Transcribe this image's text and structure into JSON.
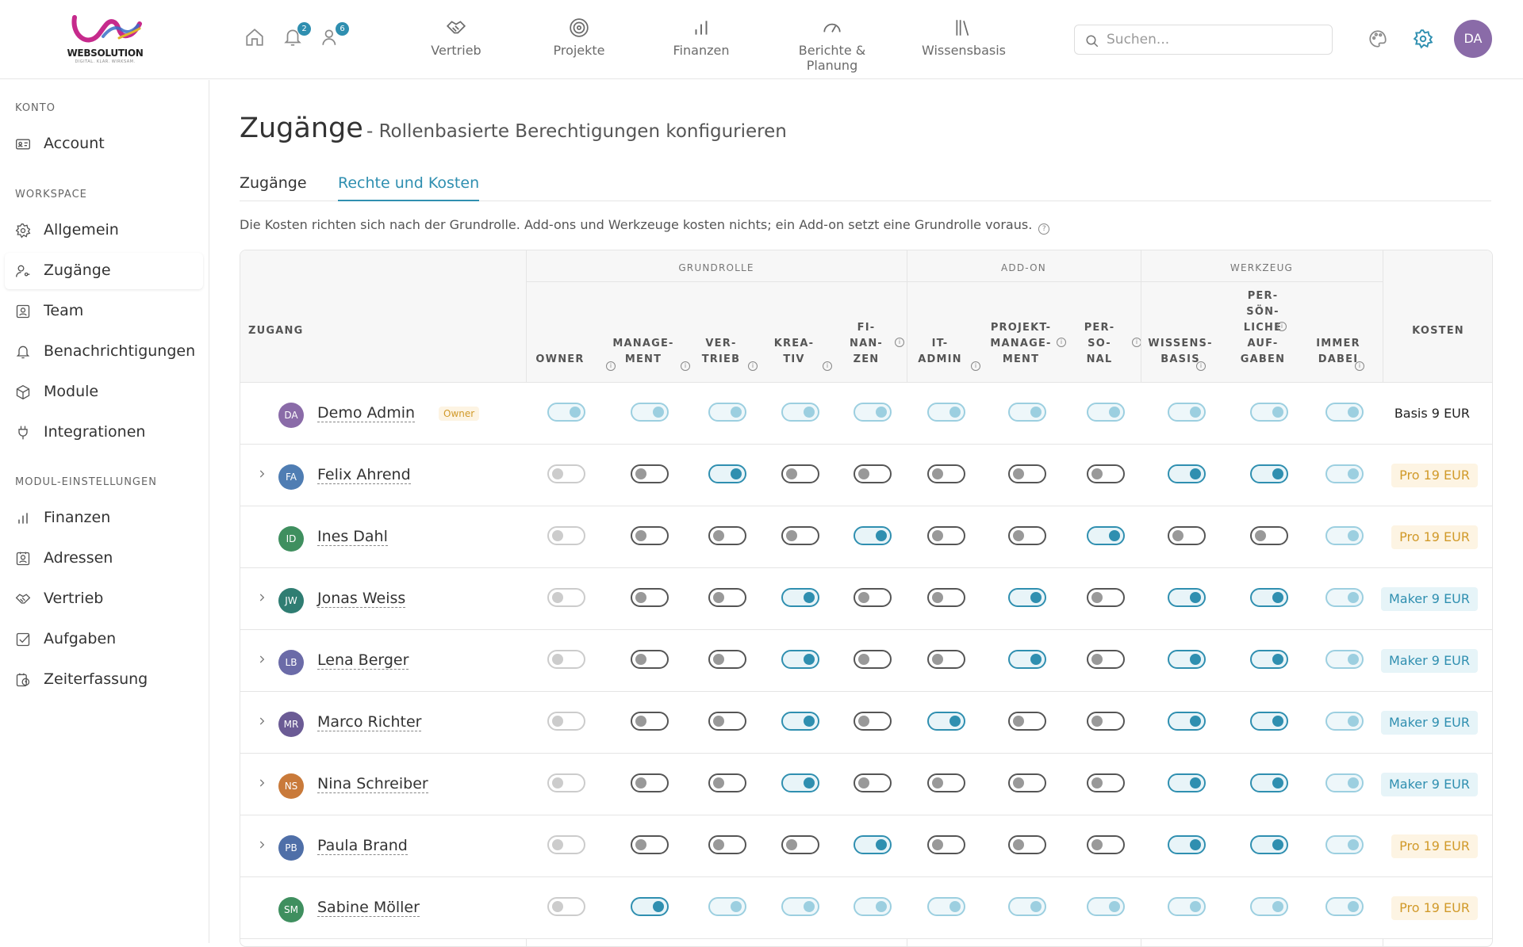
{
  "header": {
    "logo_text": "WEBSOLUTION",
    "logo_tagline": "DIGITAL. KLAR. WIRKSAM.",
    "notifications_count": "2",
    "users_count": "6",
    "nav": [
      {
        "label": "Vertrieb",
        "icon": "handshake-icon"
      },
      {
        "label": "Projekte",
        "icon": "target-icon"
      },
      {
        "label": "Finanzen",
        "icon": "bar-chart-icon"
      },
      {
        "label": "Berichte & Planung",
        "icon": "gauge-icon"
      },
      {
        "label": "Wissensbasis",
        "icon": "library-icon"
      }
    ],
    "search_placeholder": "Suchen...",
    "user_initials": "DA"
  },
  "sidebar": {
    "sections": [
      "KONTO",
      "WORKSPACE",
      "MODUL-EINSTELLUNGEN"
    ],
    "konto": [
      {
        "label": "Account",
        "icon": "id-card-icon"
      }
    ],
    "workspace": [
      {
        "label": "Allgemein",
        "icon": "gear-icon"
      },
      {
        "label": "Zugänge",
        "icon": "user-key-icon"
      },
      {
        "label": "Team",
        "icon": "team-icon"
      },
      {
        "label": "Benachrichtigungen",
        "icon": "bell-icon"
      },
      {
        "label": "Module",
        "icon": "box-icon"
      },
      {
        "label": "Integrationen",
        "icon": "plug-icon"
      }
    ],
    "modul": [
      {
        "label": "Finanzen",
        "icon": "bar-chart-icon"
      },
      {
        "label": "Adressen",
        "icon": "contact-icon"
      },
      {
        "label": "Vertrieb",
        "icon": "handshake-icon"
      },
      {
        "label": "Aufgaben",
        "icon": "checkbox-icon"
      },
      {
        "label": "Zeiterfassung",
        "icon": "timer-icon"
      }
    ]
  },
  "page": {
    "title": "Zugänge",
    "subtitle": "- Rollenbasierte Berechtigungen konfigurieren",
    "tabs": [
      "Zugänge",
      "Rechte und Kosten"
    ],
    "active_tab": "Rechte und Kosten",
    "description": "Die Kosten richten sich nach der Grundrolle. Add-ons und Werkzeuge kosten nichts; ein Add-on setzt eine Grundrolle voraus."
  },
  "table": {
    "col_zugang": "ZUGANG",
    "col_kosten": "KOSTEN",
    "groups": [
      "GRUNDROLLE",
      "ADD-ON",
      "WERKZEUG"
    ],
    "columns": [
      {
        "lines": [
          "OWNER"
        ],
        "info": true
      },
      {
        "lines": [
          "MANAGE-",
          "MENT"
        ],
        "info": true
      },
      {
        "lines": [
          "VER-",
          "TRIEB"
        ],
        "info": true
      },
      {
        "lines": [
          "KREA-",
          "TIV"
        ],
        "info": true
      },
      {
        "lines": [
          "FI-",
          "NAN-",
          "ZEN"
        ],
        "info": true
      },
      {
        "lines": [
          "IT-",
          "ADMIN"
        ],
        "info": true
      },
      {
        "lines": [
          "PROJEKT-",
          "MANAGE-",
          "MENT"
        ],
        "info": true
      },
      {
        "lines": [
          "PER-",
          "SO-",
          "NAL"
        ],
        "info": true
      },
      {
        "lines": [
          "WISSENS-",
          "BASIS"
        ],
        "info": true
      },
      {
        "lines": [
          "PER-",
          "SÖN-",
          "LICHE",
          "AUF-",
          "GABEN"
        ],
        "info": true
      },
      {
        "lines": [
          "IMMER",
          "DABEI"
        ],
        "info": true
      }
    ],
    "owner_tag": "Owner",
    "rows": [
      {
        "initials": "DA",
        "name": "Demo Admin",
        "color": "#8a6ba8",
        "expand": false,
        "owner": true,
        "toggles": [
          "dison",
          "dison",
          "dison",
          "dison",
          "dison",
          "dison",
          "dison",
          "dison",
          "dison",
          "dison",
          "dison"
        ],
        "cost": "Basis 9 EUR",
        "cost_type": "basis"
      },
      {
        "initials": "FA",
        "name": "Felix Ahrend",
        "color": "#4f7db3",
        "expand": true,
        "owner": false,
        "toggles": [
          "dis",
          "off",
          "on",
          "off",
          "off",
          "off",
          "off",
          "off",
          "on",
          "on",
          "dison"
        ],
        "cost": "Pro 19 EUR",
        "cost_type": "pro"
      },
      {
        "initials": "ID",
        "name": "Ines Dahl",
        "color": "#3f8f5f",
        "expand": false,
        "owner": false,
        "toggles": [
          "dis",
          "off",
          "off",
          "off",
          "on",
          "off",
          "off",
          "on",
          "off",
          "off",
          "dison"
        ],
        "cost": "Pro 19 EUR",
        "cost_type": "pro"
      },
      {
        "initials": "JW",
        "name": "Jonas Weiss",
        "color": "#2f7d72",
        "expand": true,
        "owner": false,
        "toggles": [
          "dis",
          "off",
          "off",
          "on",
          "off",
          "off",
          "on",
          "off",
          "on",
          "on",
          "dison"
        ],
        "cost": "Maker 9 EUR",
        "cost_type": "maker"
      },
      {
        "initials": "LB",
        "name": "Lena Berger",
        "color": "#6b6ba8",
        "expand": true,
        "owner": false,
        "toggles": [
          "dis",
          "off",
          "off",
          "on",
          "off",
          "off",
          "on",
          "off",
          "on",
          "on",
          "dison"
        ],
        "cost": "Maker 9 EUR",
        "cost_type": "maker"
      },
      {
        "initials": "MR",
        "name": "Marco Richter",
        "color": "#6b5b95",
        "expand": true,
        "owner": false,
        "toggles": [
          "dis",
          "off",
          "off",
          "on",
          "off",
          "on",
          "off",
          "off",
          "on",
          "on",
          "dison"
        ],
        "cost": "Maker 9 EUR",
        "cost_type": "maker"
      },
      {
        "initials": "NS",
        "name": "Nina Schreiber",
        "color": "#c97a3a",
        "expand": true,
        "owner": false,
        "toggles": [
          "dis",
          "off",
          "off",
          "on",
          "off",
          "off",
          "off",
          "off",
          "on",
          "on",
          "dison"
        ],
        "cost": "Maker 9 EUR",
        "cost_type": "maker"
      },
      {
        "initials": "PB",
        "name": "Paula Brand",
        "color": "#4f6fa8",
        "expand": true,
        "owner": false,
        "toggles": [
          "dis",
          "off",
          "off",
          "off",
          "on",
          "off",
          "off",
          "off",
          "on",
          "on",
          "dison"
        ],
        "cost": "Pro 19 EUR",
        "cost_type": "pro"
      },
      {
        "initials": "SM",
        "name": "Sabine Möller",
        "color": "#3f8f5f",
        "expand": false,
        "owner": false,
        "toggles": [
          "dis",
          "on",
          "dison",
          "dison",
          "dison",
          "dison",
          "dison",
          "dison",
          "dison",
          "dison",
          "dison"
        ],
        "cost": "Pro 19 EUR",
        "cost_type": "pro"
      }
    ]
  }
}
